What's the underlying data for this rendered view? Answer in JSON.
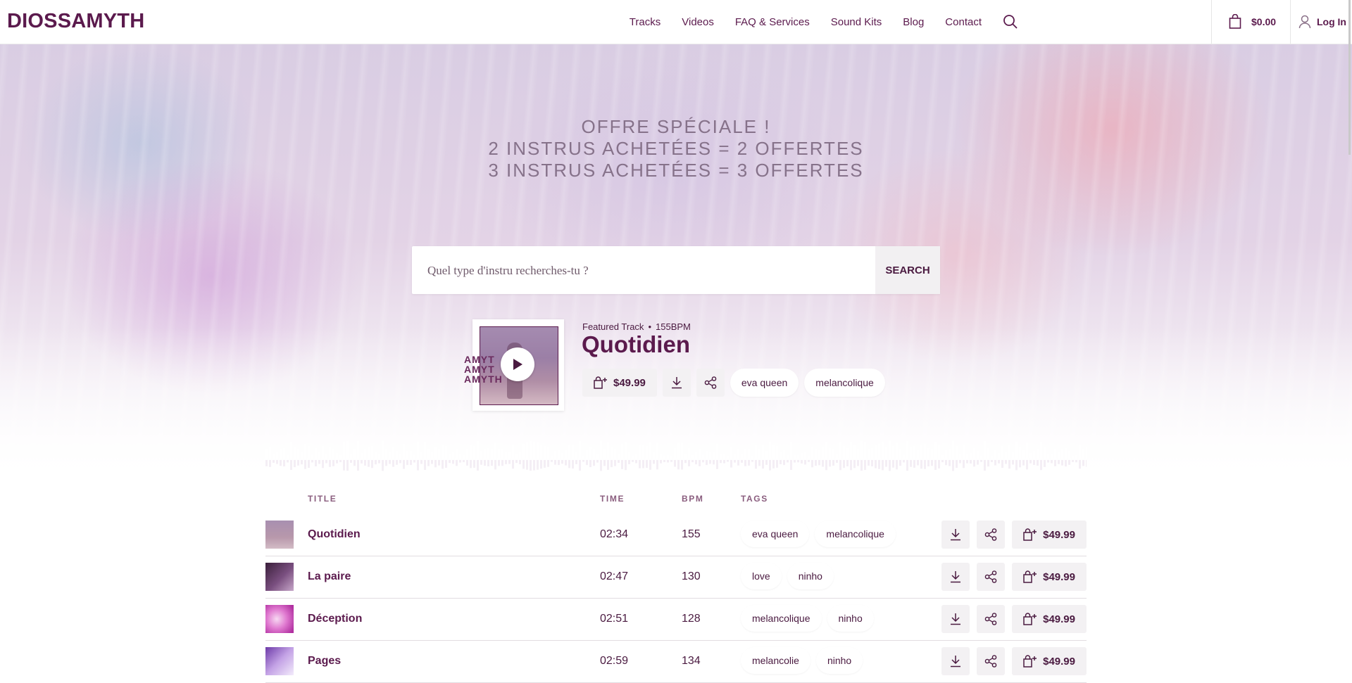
{
  "header": {
    "logo": "DIOSSAMYTH",
    "nav": [
      "Tracks",
      "Videos",
      "FAQ & Services",
      "Sound Kits",
      "Blog",
      "Contact"
    ],
    "cart_total": "$0.00",
    "login_label": "Log In"
  },
  "hero": {
    "promo_lines": [
      "OFFRE SPÉCIALE !",
      "2 INSTRUS ACHETÉES = 2 OFFERTES",
      "3 INSTRUS ACHETÉES = 3 OFFERTES"
    ],
    "search": {
      "placeholder": "Quel type d'instru recherches-tu ?",
      "button_label": "SEARCH"
    },
    "featured": {
      "label": "Featured Track",
      "separator": "•",
      "bpm": "155BPM",
      "title": "Quotidien",
      "price": "$49.99",
      "tags": [
        "eva queen",
        "melancolique"
      ],
      "cover_watermark": [
        "AMYT",
        "AMYT",
        "AMYTH"
      ]
    }
  },
  "tracks": {
    "columns": {
      "title": "TITLE",
      "time": "TIME",
      "bpm": "BPM",
      "tags": "TAGS"
    },
    "rows": [
      {
        "title": "Quotidien",
        "time": "02:34",
        "bpm": "155",
        "tags": [
          "eva queen",
          "melancolique"
        ],
        "price": "$49.99"
      },
      {
        "title": "La paire",
        "time": "02:47",
        "bpm": "130",
        "tags": [
          "love",
          "ninho"
        ],
        "price": "$49.99"
      },
      {
        "title": "Déception",
        "time": "02:51",
        "bpm": "128",
        "tags": [
          "melancolique",
          "ninho"
        ],
        "price": "$49.99"
      },
      {
        "title": "Pages",
        "time": "02:59",
        "bpm": "134",
        "tags": [
          "melancolie",
          "ninho"
        ],
        "price": "$49.99"
      }
    ]
  },
  "colors": {
    "brand": "#5b1a4d",
    "button_bg": "#f3f1f3",
    "promo_text": "#86728a"
  },
  "icons": [
    "search-icon",
    "shopping-bag-icon",
    "user-icon",
    "play-icon",
    "add-to-cart-icon",
    "download-icon",
    "share-icon"
  ]
}
